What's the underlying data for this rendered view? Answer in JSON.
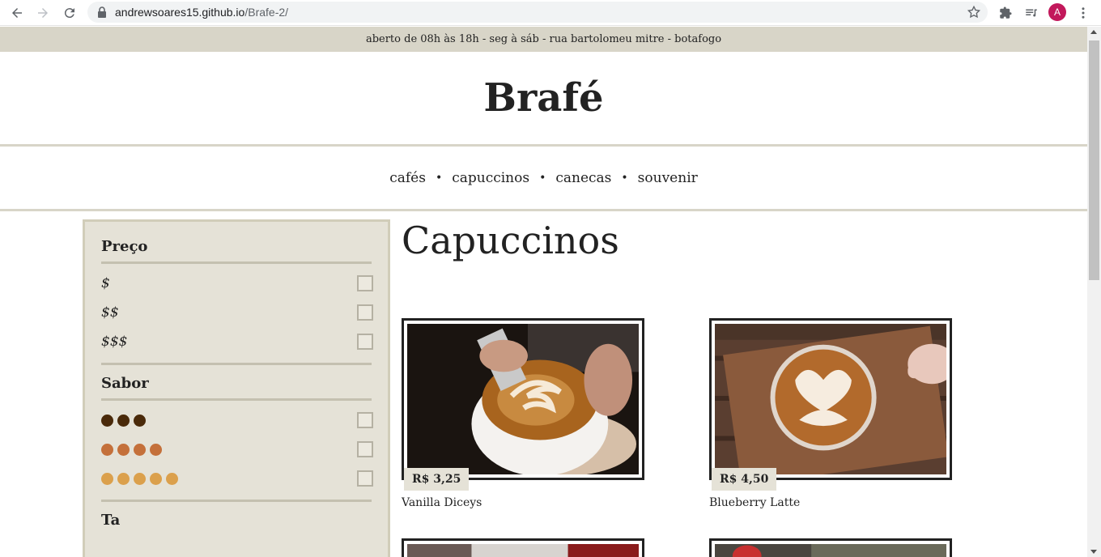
{
  "browser": {
    "url_host": "andrewsoares15.github.io",
    "url_path": "/Brafe-2/",
    "profile_initial": "A"
  },
  "site": {
    "info_bar": "aberto de 08h às 18h - seg à sáb - rua bartolomeu mitre - botafogo",
    "brand": "Brafé",
    "menu": [
      {
        "label": "cafés"
      },
      {
        "label": "capuccinos"
      },
      {
        "label": "canecas"
      },
      {
        "label": "souvenir"
      }
    ],
    "menu_separator": "•"
  },
  "filters": {
    "price": {
      "title": "Preço",
      "options": [
        {
          "label": "$"
        },
        {
          "label": "$$"
        },
        {
          "label": "$$$"
        }
      ]
    },
    "flavor": {
      "title": "Sabor",
      "options": [
        {
          "dots": 3,
          "color": "#4a2a0a"
        },
        {
          "dots": 4,
          "color": "#c4703a"
        },
        {
          "dots": 5,
          "color": "#dba04c"
        }
      ]
    },
    "next_title": "Ta"
  },
  "section": {
    "title": "Capuccinos"
  },
  "products": [
    {
      "name": "Vanilla Diceys",
      "price": "R$ 3,25"
    },
    {
      "name": "Blueberry Latte",
      "price": "R$ 4,50"
    }
  ],
  "colors": {
    "beige": "#e5e2d7",
    "bar": "#d8d5c8"
  }
}
